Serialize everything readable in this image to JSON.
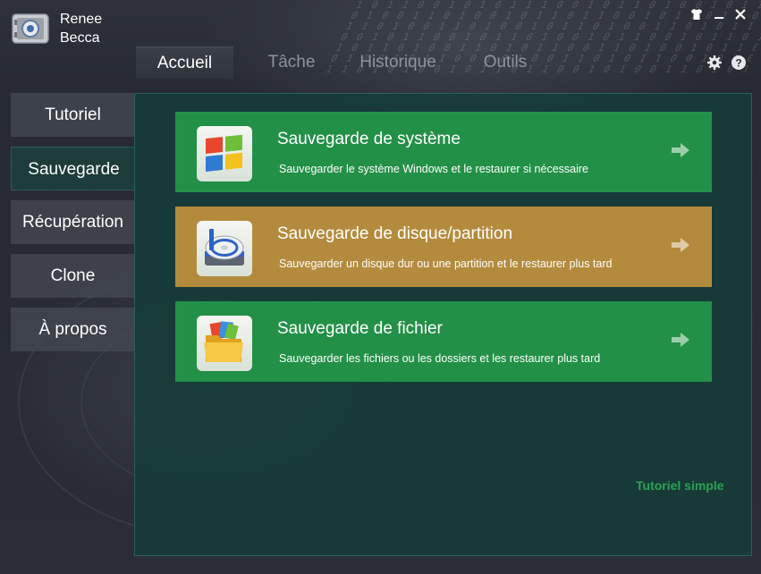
{
  "app": {
    "name_line1": "Renee",
    "name_line2": "Becca"
  },
  "window_controls": {
    "skin_icon": "tshirt-icon",
    "minimize_icon": "minimize-icon",
    "close_icon": "close-icon"
  },
  "tabs": [
    {
      "label": "Accueil",
      "active": true
    },
    {
      "label": "Tâche",
      "active": false
    },
    {
      "label": "Historique",
      "active": false
    },
    {
      "label": "Outils",
      "active": false
    }
  ],
  "toolbar": {
    "settings_icon": "gear-icon",
    "help_icon": "help-icon"
  },
  "sidebar": {
    "items": [
      {
        "label": "Tutoriel",
        "active": false
      },
      {
        "label": "Sauvegarde",
        "active": true
      },
      {
        "label": "Récupération",
        "active": false
      },
      {
        "label": "Clone",
        "active": false
      },
      {
        "label": "À propos",
        "active": false
      }
    ]
  },
  "cards": [
    {
      "title": "Sauvegarde de système",
      "description": "Sauvegarder le système Windows et le restaurer si nécessaire",
      "icon": "windows-logo-icon",
      "color": "#239048"
    },
    {
      "title": "Sauvegarde de disque/partition",
      "description": "Sauvegarder un disque dur ou une partition et le restaurer plus tard",
      "icon": "hard-disk-icon",
      "color": "#b48b3d"
    },
    {
      "title": "Sauvegarde de fichier",
      "description": "Sauvegarder les fichiers ou les dossiers et les restaurer plus tard",
      "icon": "folder-icon",
      "color": "#239048"
    }
  ],
  "tutorial_link": "Tutoriel simple",
  "colors": {
    "accent_green": "#239048",
    "accent_gold": "#b48b3d",
    "panel_bg": "#163c3a",
    "link_green": "#2aa34f"
  }
}
